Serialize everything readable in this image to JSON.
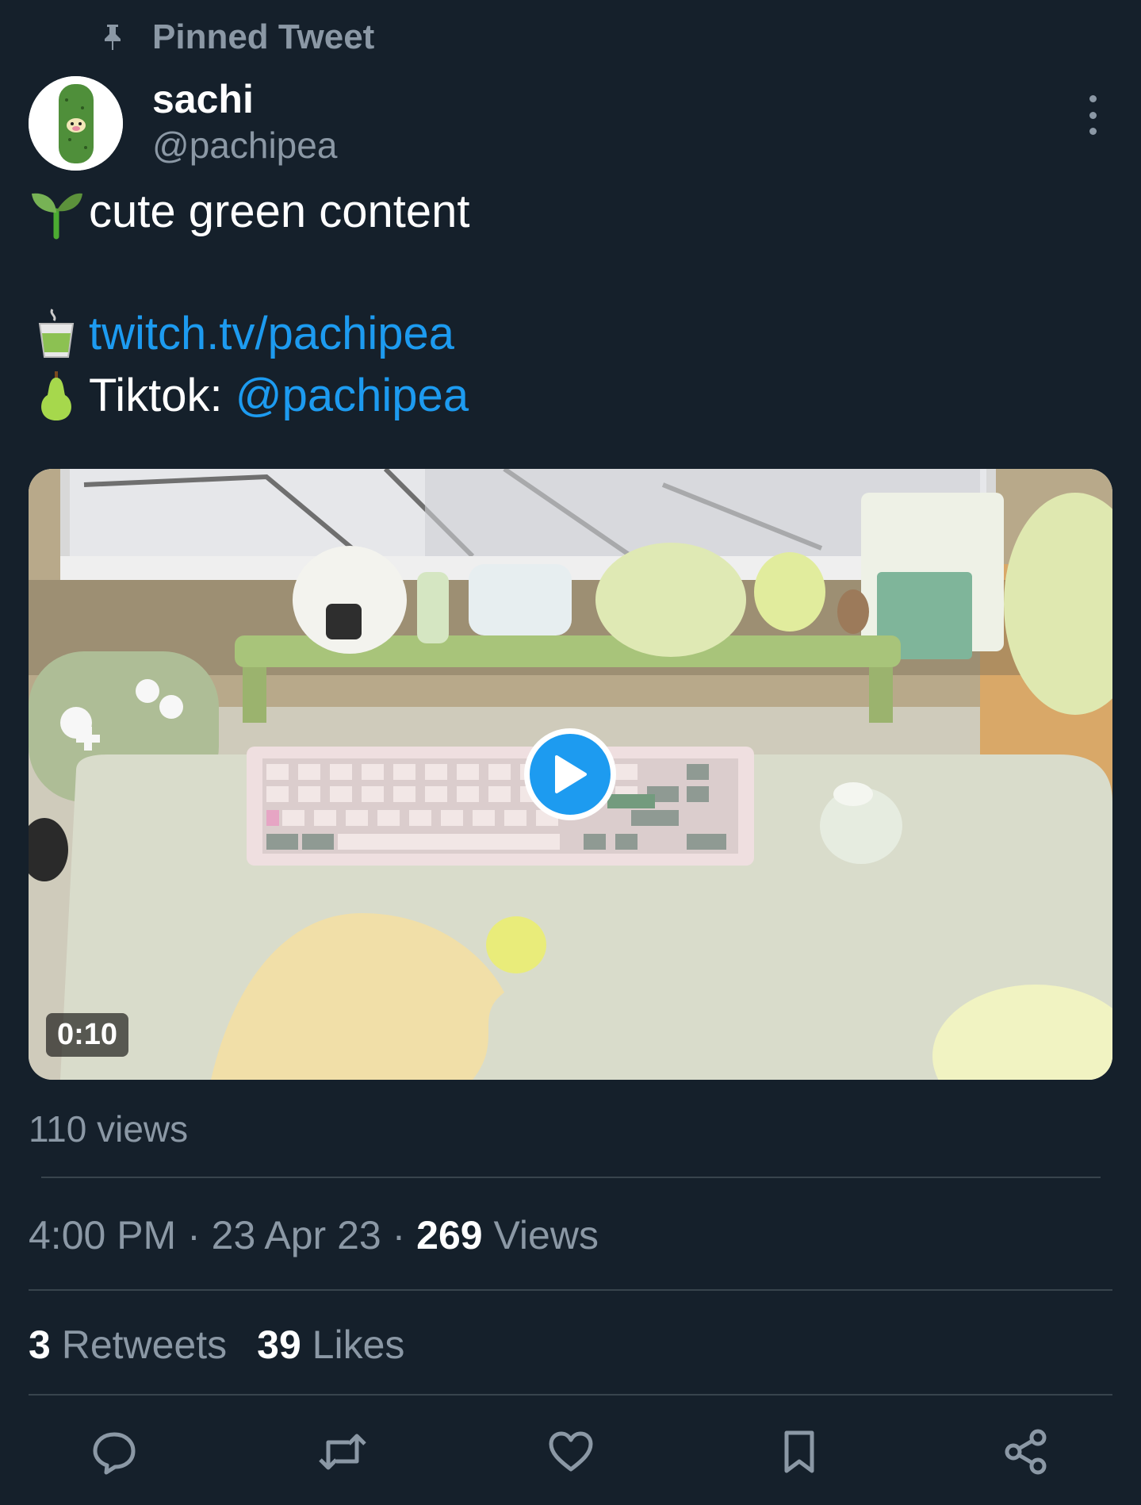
{
  "pinned_label": "Pinned Tweet",
  "author": {
    "display_name": "sachi",
    "handle": "@pachipea"
  },
  "tweet": {
    "bio_line": "cute green content",
    "twitch_link": "twitch.tv/pachipea",
    "tiktok_prefix": "Tiktok: ",
    "tiktok_handle": "@pachipea"
  },
  "media": {
    "duration": "0:10",
    "views": "110 views"
  },
  "meta": {
    "time": "4:00 PM",
    "separator": " · ",
    "date": "23 Apr 23",
    "views_count": "269",
    "views_label": " Views"
  },
  "stats": {
    "retweets_count": "3",
    "retweets_label": " Retweets",
    "likes_count": "39",
    "likes_label": " Likes"
  },
  "icons": {
    "pin": "pin-icon",
    "more": "more-vertical-icon",
    "seedling": "seedling-emoji",
    "tea": "tea-emoji",
    "pear": "pear-emoji",
    "play": "play-icon",
    "reply": "reply-icon",
    "retweet": "retweet-icon",
    "like": "heart-icon",
    "bookmark": "bookmark-icon",
    "share": "share-icon"
  },
  "colors": {
    "background": "#15202b",
    "accent": "#1d9bf0",
    "secondary_text": "#8b98a5",
    "divider": "#38444d"
  }
}
